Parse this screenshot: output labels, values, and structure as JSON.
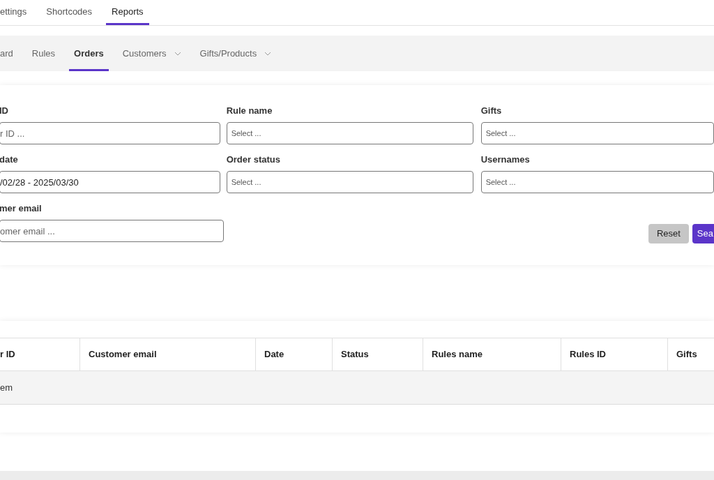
{
  "top_tabs": [
    {
      "label": "ettings",
      "selected": false
    },
    {
      "label": "Shortcodes",
      "selected": false
    },
    {
      "label": "Reports",
      "selected": true
    }
  ],
  "sub_tabs": [
    {
      "label": "ard",
      "selected": false,
      "dropdown": false
    },
    {
      "label": "Rules",
      "selected": false,
      "dropdown": false
    },
    {
      "label": "Orders",
      "selected": true,
      "dropdown": false
    },
    {
      "label": "Customers",
      "selected": false,
      "dropdown": true
    },
    {
      "label": "Gifts/Products",
      "selected": false,
      "dropdown": true
    }
  ],
  "filters": [
    {
      "label": "ID",
      "kind": "text",
      "placeholder": "r ID ..."
    },
    {
      "label": "Rule name",
      "kind": "select",
      "placeholder": "Select ..."
    },
    {
      "label": "Gifts",
      "kind": "select",
      "placeholder": "Select ..."
    },
    {
      "label": "date",
      "kind": "text",
      "value": "/02/28 - 2025/03/30"
    },
    {
      "label": "Order status",
      "kind": "select",
      "placeholder": "Select ..."
    },
    {
      "label": "Usernames",
      "kind": "select",
      "placeholder": "Select ..."
    },
    {
      "label": "mer email",
      "kind": "text",
      "placeholder": "omer email ..."
    }
  ],
  "buttons": [
    {
      "label": "Reset",
      "kind": "secondary"
    },
    {
      "label": "Sea",
      "kind": "primary"
    }
  ],
  "table": {
    "columns": [
      "r ID",
      "Customer email",
      "Date",
      "Status",
      "Rules name",
      "Rules ID",
      "Gifts"
    ],
    "empty_message": "em"
  }
}
